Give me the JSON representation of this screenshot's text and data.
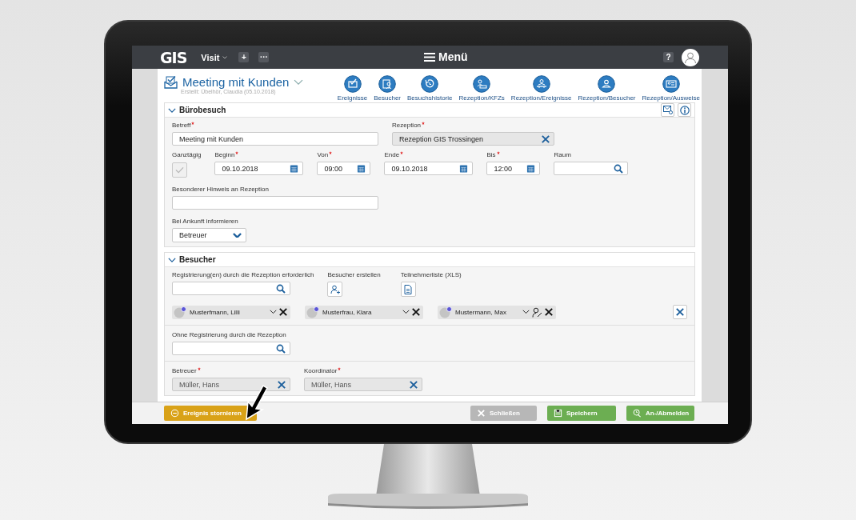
{
  "header": {
    "logo": "GIS",
    "app_menu": "Visit",
    "buttons": [
      "+",
      "···"
    ],
    "menu": "Menü",
    "help": "?"
  },
  "title": {
    "text": "Meeting mit Kunden",
    "subtitle": "Erstellt: Übelhör, Claudia (05.10.2018)"
  },
  "nav": [
    {
      "label": "Ereignisse",
      "kind": "events"
    },
    {
      "label": "Besucher",
      "kind": "visitors"
    },
    {
      "label": "Besuchshistorie",
      "kind": "history"
    },
    {
      "label": "Rezeption/KFZs",
      "kind": "cars"
    },
    {
      "label": "Rezeption/Ereignisse",
      "kind": "desk"
    },
    {
      "label": "Rezeption/Besucher",
      "kind": "person"
    },
    {
      "label": "Rezeption/Ausweise",
      "kind": "badge"
    }
  ],
  "sections": [
    {
      "title": "Bürobesuch",
      "expanded": true,
      "tools": true,
      "rows": [
        {
          "separated": false,
          "fields": [
            {
              "kind": "text",
              "label": "Betreff",
              "required": true,
              "value": "Meeting mit Kunden"
            },
            {
              "kind": "select",
              "label": "Rezeption",
              "required": true,
              "value": "Rezeption GIS Trossingen"
            }
          ]
        },
        {
          "separated": false,
          "fields": [
            {
              "kind": "checkbox",
              "label": "Ganztägig",
              "required": false,
              "checked": false
            },
            {
              "kind": "date",
              "label": "Beginn",
              "required": true,
              "value": "09.10.2018"
            },
            {
              "kind": "time",
              "label": "Von",
              "required": true,
              "value": "09:00"
            },
            {
              "kind": "date",
              "label": "Ende",
              "required": true,
              "value": "09.10.2018"
            },
            {
              "kind": "time",
              "label": "Bis",
              "required": true,
              "value": "12:00"
            },
            {
              "kind": "search",
              "label": "Raum",
              "required": false
            }
          ]
        },
        {
          "separated": false,
          "fields": [
            {
              "kind": "text",
              "label": "Besonderer Hinweis an Rezeption",
              "required": false
            }
          ]
        },
        {
          "separated": false,
          "fields": [
            {
              "kind": "dropdown",
              "label": "Bei Ankunft informieren",
              "required": false,
              "value": "Betreuer"
            }
          ]
        }
      ]
    },
    {
      "title": "Besucher",
      "expanded": true,
      "tools": false,
      "rows": [
        {
          "separated": false,
          "fields": [
            {
              "kind": "search",
              "label": "Registrierung(en) durch die Rezeption erforderlich",
              "required": false
            },
            {
              "kind": "add-person",
              "label": "Besucher erstellen",
              "required": false
            },
            {
              "kind": "document",
              "label": "Teilnehmerliste (XLS)",
              "required": false
            }
          ]
        },
        {
          "separated": false,
          "fields": [
            {
              "kind": "chips",
              "items": [
                {
                  "name": "Musterfmann, Lilli",
                  "editable": false
                },
                {
                  "name": "Musterfrau, Klara",
                  "editable": false
                },
                {
                  "name": "Mustermann, Max",
                  "editable": true
                }
              ]
            }
          ]
        },
        {
          "separated": true,
          "fields": [
            {
              "kind": "search",
              "label": "Ohne Registrierung durch die Rezeption",
              "required": false
            }
          ]
        },
        {
          "separated": true,
          "fields": [
            {
              "kind": "person",
              "label": "Betreuer",
              "required": true,
              "value": "Müller, Hans"
            },
            {
              "kind": "person",
              "label": "Koordinator",
              "required": true,
              "value": "Müller, Hans"
            }
          ]
        }
      ]
    }
  ],
  "footer": [
    {
      "label": "Ereignis stornieren",
      "kind": "cancel",
      "disabled": false
    },
    {
      "label": "Schließen",
      "kind": "close",
      "disabled": true
    },
    {
      "label": "Speichern",
      "kind": "save",
      "disabled": false
    },
    {
      "label": "An-/Abmelden",
      "kind": "register",
      "disabled": false
    }
  ]
}
